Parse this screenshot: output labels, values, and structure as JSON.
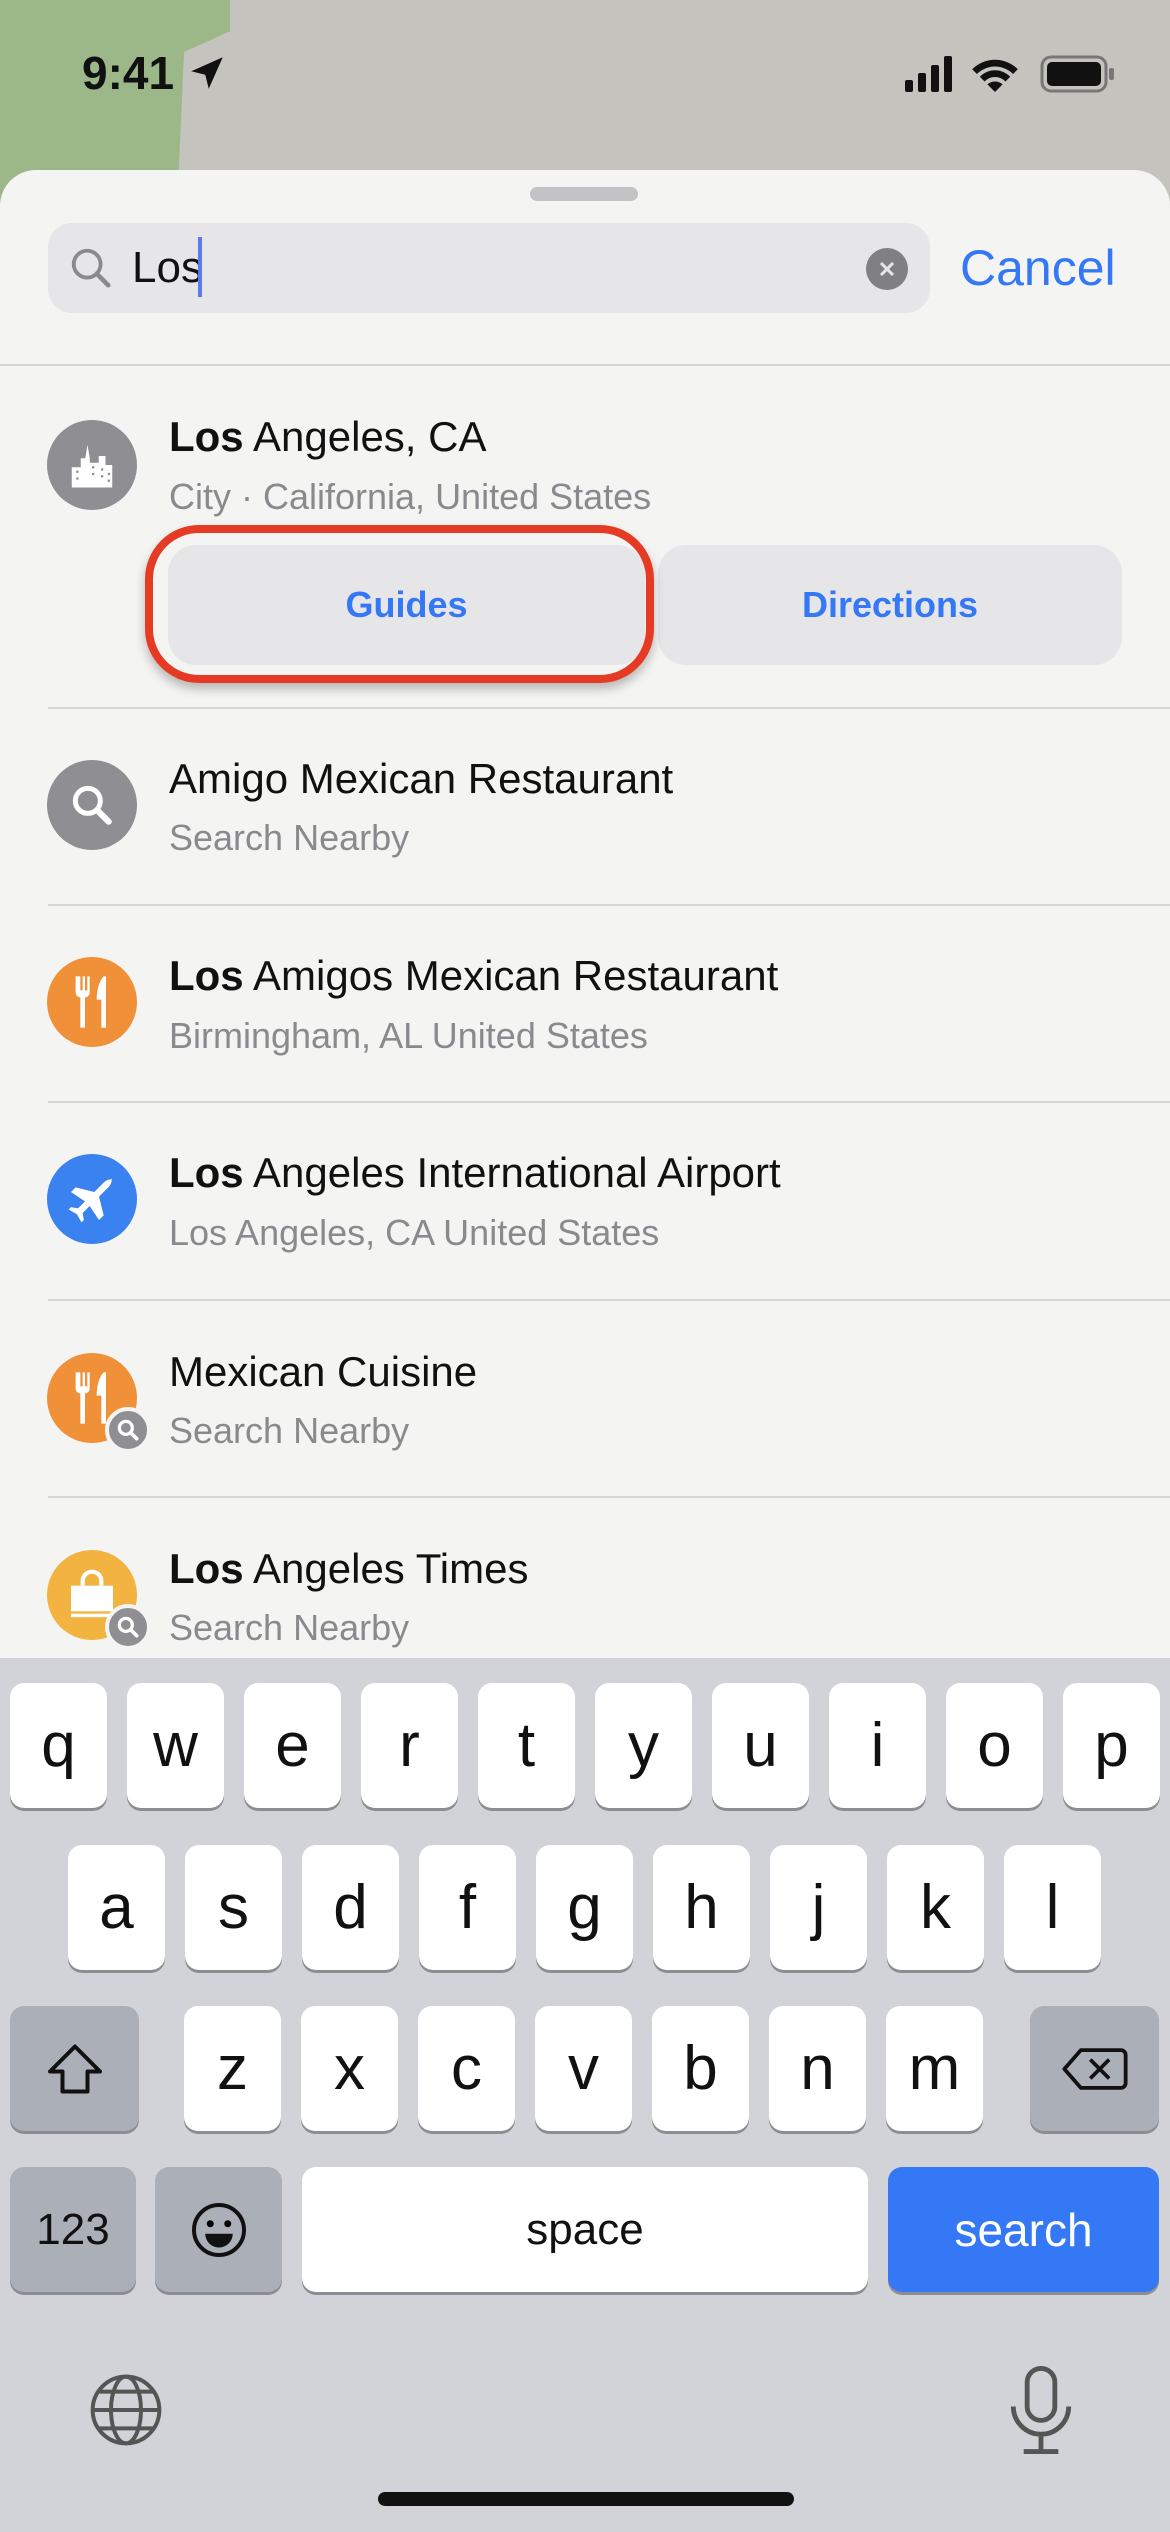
{
  "status_bar": {
    "time": "9:41",
    "icons": [
      "location-arrow-icon",
      "cellular-signal-icon",
      "wifi-icon",
      "battery-icon"
    ]
  },
  "search": {
    "value": "Los",
    "icon": "search-icon",
    "clear_icon": "clear-icon",
    "cancel_label": "Cancel"
  },
  "colors": {
    "accent": "#3478f6",
    "highlight_ring": "#e53b25",
    "keyboard_bg": "#d1d3d9"
  },
  "results": [
    {
      "title_bold": "Los",
      "title_rest": " Angeles, CA",
      "subtitle": "City · California, United States",
      "icon": "city-icon",
      "icon_color": "#8e8e93",
      "actions": [
        "Guides",
        "Directions"
      ]
    },
    {
      "title_bold": "",
      "title_rest": "Amigo Mexican Restaurant",
      "subtitle": "Search Nearby",
      "icon": "search-icon",
      "icon_color": "#8e8e93"
    },
    {
      "title_bold": "Los",
      "title_rest": " Amigos Mexican Restaurant",
      "subtitle": "Birmingham, AL  United States",
      "icon": "fork-knife-icon",
      "icon_color": "#f0913a"
    },
    {
      "title_bold": "Los",
      "title_rest": " Angeles International Airport",
      "subtitle": "Los Angeles, CA  United States",
      "icon": "airplane-icon",
      "icon_color": "#3a82f0"
    },
    {
      "title_bold": "",
      "title_rest": "Mexican Cuisine",
      "subtitle": "Search Nearby",
      "icon": "fork-knife-icon",
      "icon_color": "#f0913a",
      "badge": "search-icon"
    },
    {
      "title_bold": "Los",
      "title_rest": " Angeles Times",
      "subtitle": "Search Nearby",
      "icon": "shopping-bag-icon",
      "icon_color": "#f2b340",
      "badge": "search-icon"
    }
  ],
  "keyboard": {
    "row1": [
      "q",
      "w",
      "e",
      "r",
      "t",
      "y",
      "u",
      "i",
      "o",
      "p"
    ],
    "row2": [
      "a",
      "s",
      "d",
      "f",
      "g",
      "h",
      "j",
      "k",
      "l"
    ],
    "row3": [
      "z",
      "x",
      "c",
      "v",
      "b",
      "n",
      "m"
    ],
    "numbers_label": "123",
    "space_label": "space",
    "search_label": "search",
    "icons": [
      "shift-icon",
      "delete-icon",
      "emoji-icon",
      "globe-icon",
      "microphone-icon"
    ]
  }
}
